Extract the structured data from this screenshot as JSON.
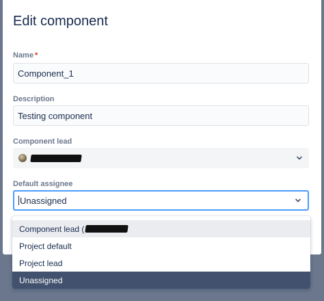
{
  "modal": {
    "title": "Edit component"
  },
  "fields": {
    "name": {
      "label": "Name",
      "required_mark": "*",
      "value": "Component_1"
    },
    "description": {
      "label": "Description",
      "value": "Testing component"
    },
    "component_lead": {
      "label": "Component lead"
    },
    "default_assignee": {
      "label": "Default assignee",
      "value": "Unassigned"
    }
  },
  "dropdown": {
    "options": [
      {
        "label": "Component lead (",
        "state": "hover"
      },
      {
        "label": "Project default",
        "state": "normal"
      },
      {
        "label": "Project lead",
        "state": "normal"
      },
      {
        "label": "Unassigned",
        "state": "selected"
      }
    ]
  },
  "colors": {
    "accent_focus": "#4c9aff",
    "selected_bg": "#42526e",
    "required": "#de350b"
  },
  "icons": {
    "select_chevron": "chevron-down-icon",
    "lead_avatar": "avatar"
  }
}
